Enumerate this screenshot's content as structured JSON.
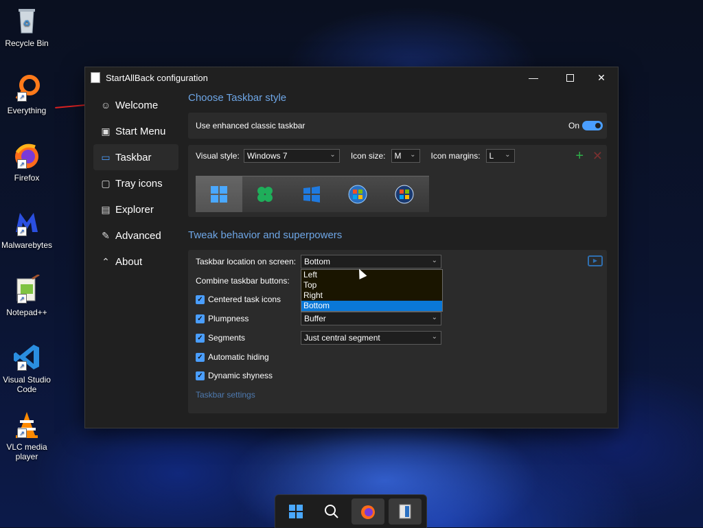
{
  "desktop": {
    "icons": [
      {
        "label": "Recycle Bin",
        "icon": "recycle-bin-icon"
      },
      {
        "label": "Everything",
        "icon": "everything-search-icon"
      },
      {
        "label": "Firefox",
        "icon": "firefox-icon"
      },
      {
        "label": "Malwarebytes",
        "icon": "malwarebytes-icon"
      },
      {
        "label": "Notepad++",
        "icon": "notepad-plus-plus-icon"
      },
      {
        "label": "Visual Studio Code",
        "icon": "vscode-icon"
      },
      {
        "label": "VLC media player",
        "icon": "vlc-icon"
      }
    ]
  },
  "window": {
    "title": "StartAllBack configuration",
    "buttons": {
      "minimize": "—",
      "close": "✕"
    }
  },
  "nav": {
    "items": [
      {
        "label": "Welcome",
        "icon": "smiley-icon",
        "glyph": "☺"
      },
      {
        "label": "Start Menu",
        "icon": "start-menu-icon",
        "glyph": "▣"
      },
      {
        "label": "Taskbar",
        "icon": "taskbar-icon",
        "glyph": "▭"
      },
      {
        "label": "Tray icons",
        "icon": "tray-icon",
        "glyph": "▢"
      },
      {
        "label": "Explorer",
        "icon": "folder-icon",
        "glyph": "▤"
      },
      {
        "label": "Advanced",
        "icon": "wrench-icon",
        "glyph": "✎"
      },
      {
        "label": "About",
        "icon": "info-icon",
        "glyph": "⌃"
      }
    ],
    "active": "Taskbar"
  },
  "taskbar_style": {
    "section_title": "Choose Taskbar style",
    "enhanced_label": "Use enhanced classic taskbar",
    "toggle_state": "On",
    "visual_style_label": "Visual style:",
    "visual_style_value": "Windows 7",
    "icon_size_label": "Icon size:",
    "icon_size_value": "M",
    "icon_margins_label": "Icon margins:",
    "icon_margins_value": "L",
    "add_glyph": "+",
    "remove_glyph": "✕"
  },
  "tweak": {
    "section_title": "Tweak behavior and superpowers",
    "location_label": "Taskbar location on screen:",
    "location_value": "Bottom",
    "combine_label": "Combine taskbar buttons:",
    "centered_label": "Centered task icons",
    "plumpness_label": "Plumpness",
    "plumpness_value": "Buffer",
    "segments_label": "Segments",
    "segments_value": "Just central segment",
    "autohide_label": "Automatic hiding",
    "shyness_label": "Dynamic shyness",
    "settings_link": "Taskbar settings",
    "check_glyph": "✓",
    "chevron_glyph": "⌄"
  },
  "dropdown": {
    "options": [
      "Left",
      "Top",
      "Right",
      "Bottom"
    ],
    "selected": "Bottom"
  },
  "colors": {
    "accent": "#4a9eff",
    "section_title": "#6ea6e6",
    "selected_option": "#0a78d7"
  }
}
